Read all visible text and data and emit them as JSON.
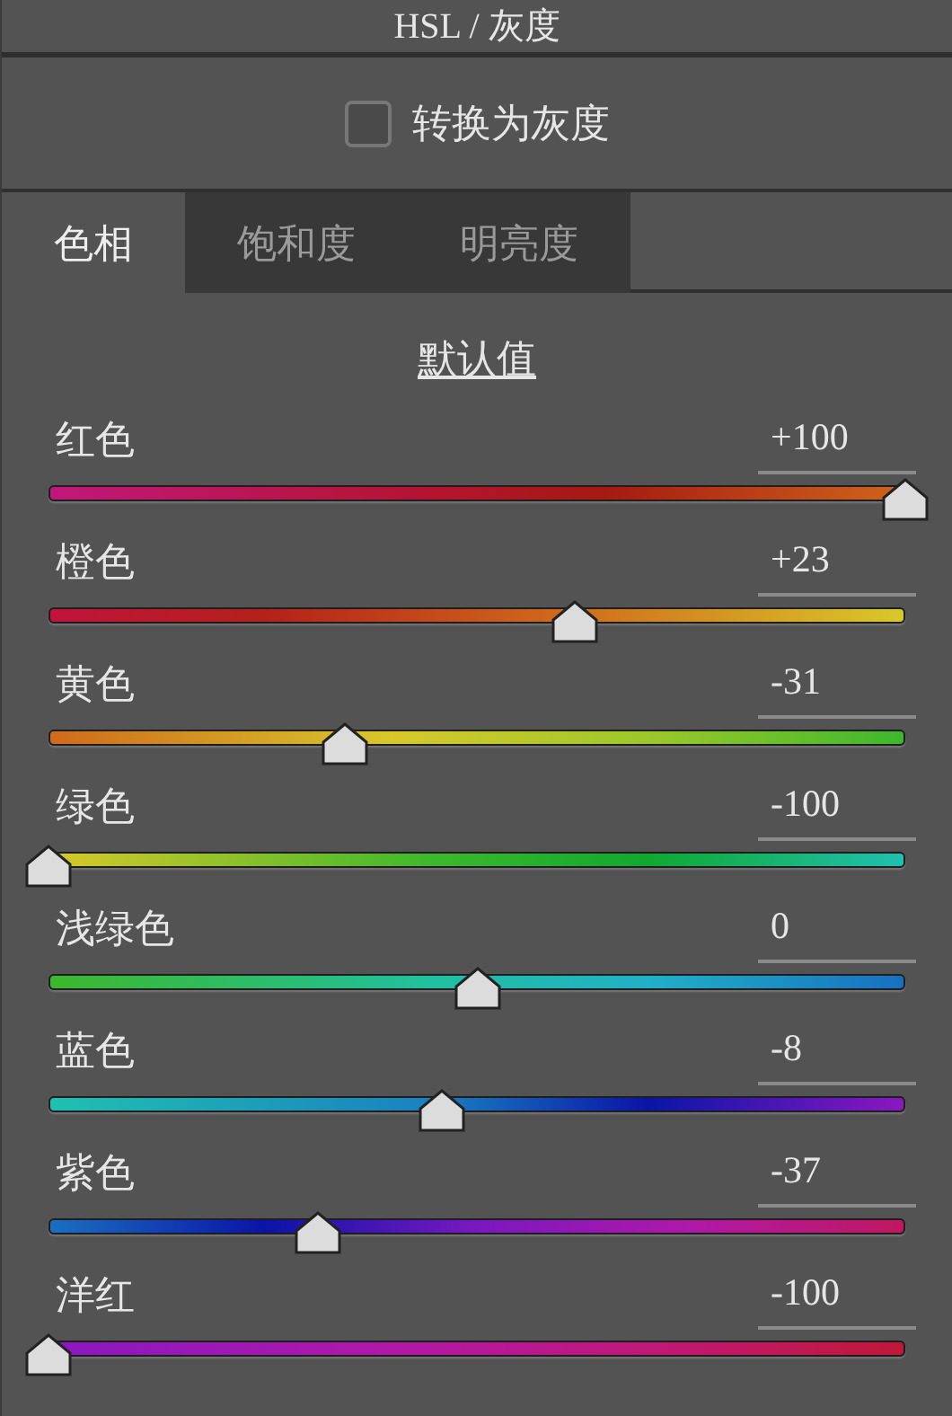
{
  "panel": {
    "title": "HSL / 灰度"
  },
  "grayscale": {
    "label": "转换为灰度",
    "checked": false
  },
  "tabs": [
    {
      "label": "色相",
      "selected": true
    },
    {
      "label": "饱和度",
      "selected": false
    },
    {
      "label": "明亮度",
      "selected": false
    }
  ],
  "defaults_link": "默认值",
  "sliders": [
    {
      "name": "红色",
      "reading": "+100",
      "level": 1
    },
    {
      "name": "橙色",
      "reading": "+23",
      "level": 0.615
    },
    {
      "name": "黄色",
      "reading": "-31",
      "level": 0.345
    },
    {
      "name": "绿色",
      "reading": "-100",
      "level": 0
    },
    {
      "name": "浅绿色",
      "reading": "0",
      "level": 0.5
    },
    {
      "name": "蓝色",
      "reading": "-8",
      "level": 0.46
    },
    {
      "name": "紫色",
      "reading": "-37",
      "level": 0.315
    },
    {
      "name": "洋红",
      "reading": "-100",
      "level": 0
    }
  ]
}
